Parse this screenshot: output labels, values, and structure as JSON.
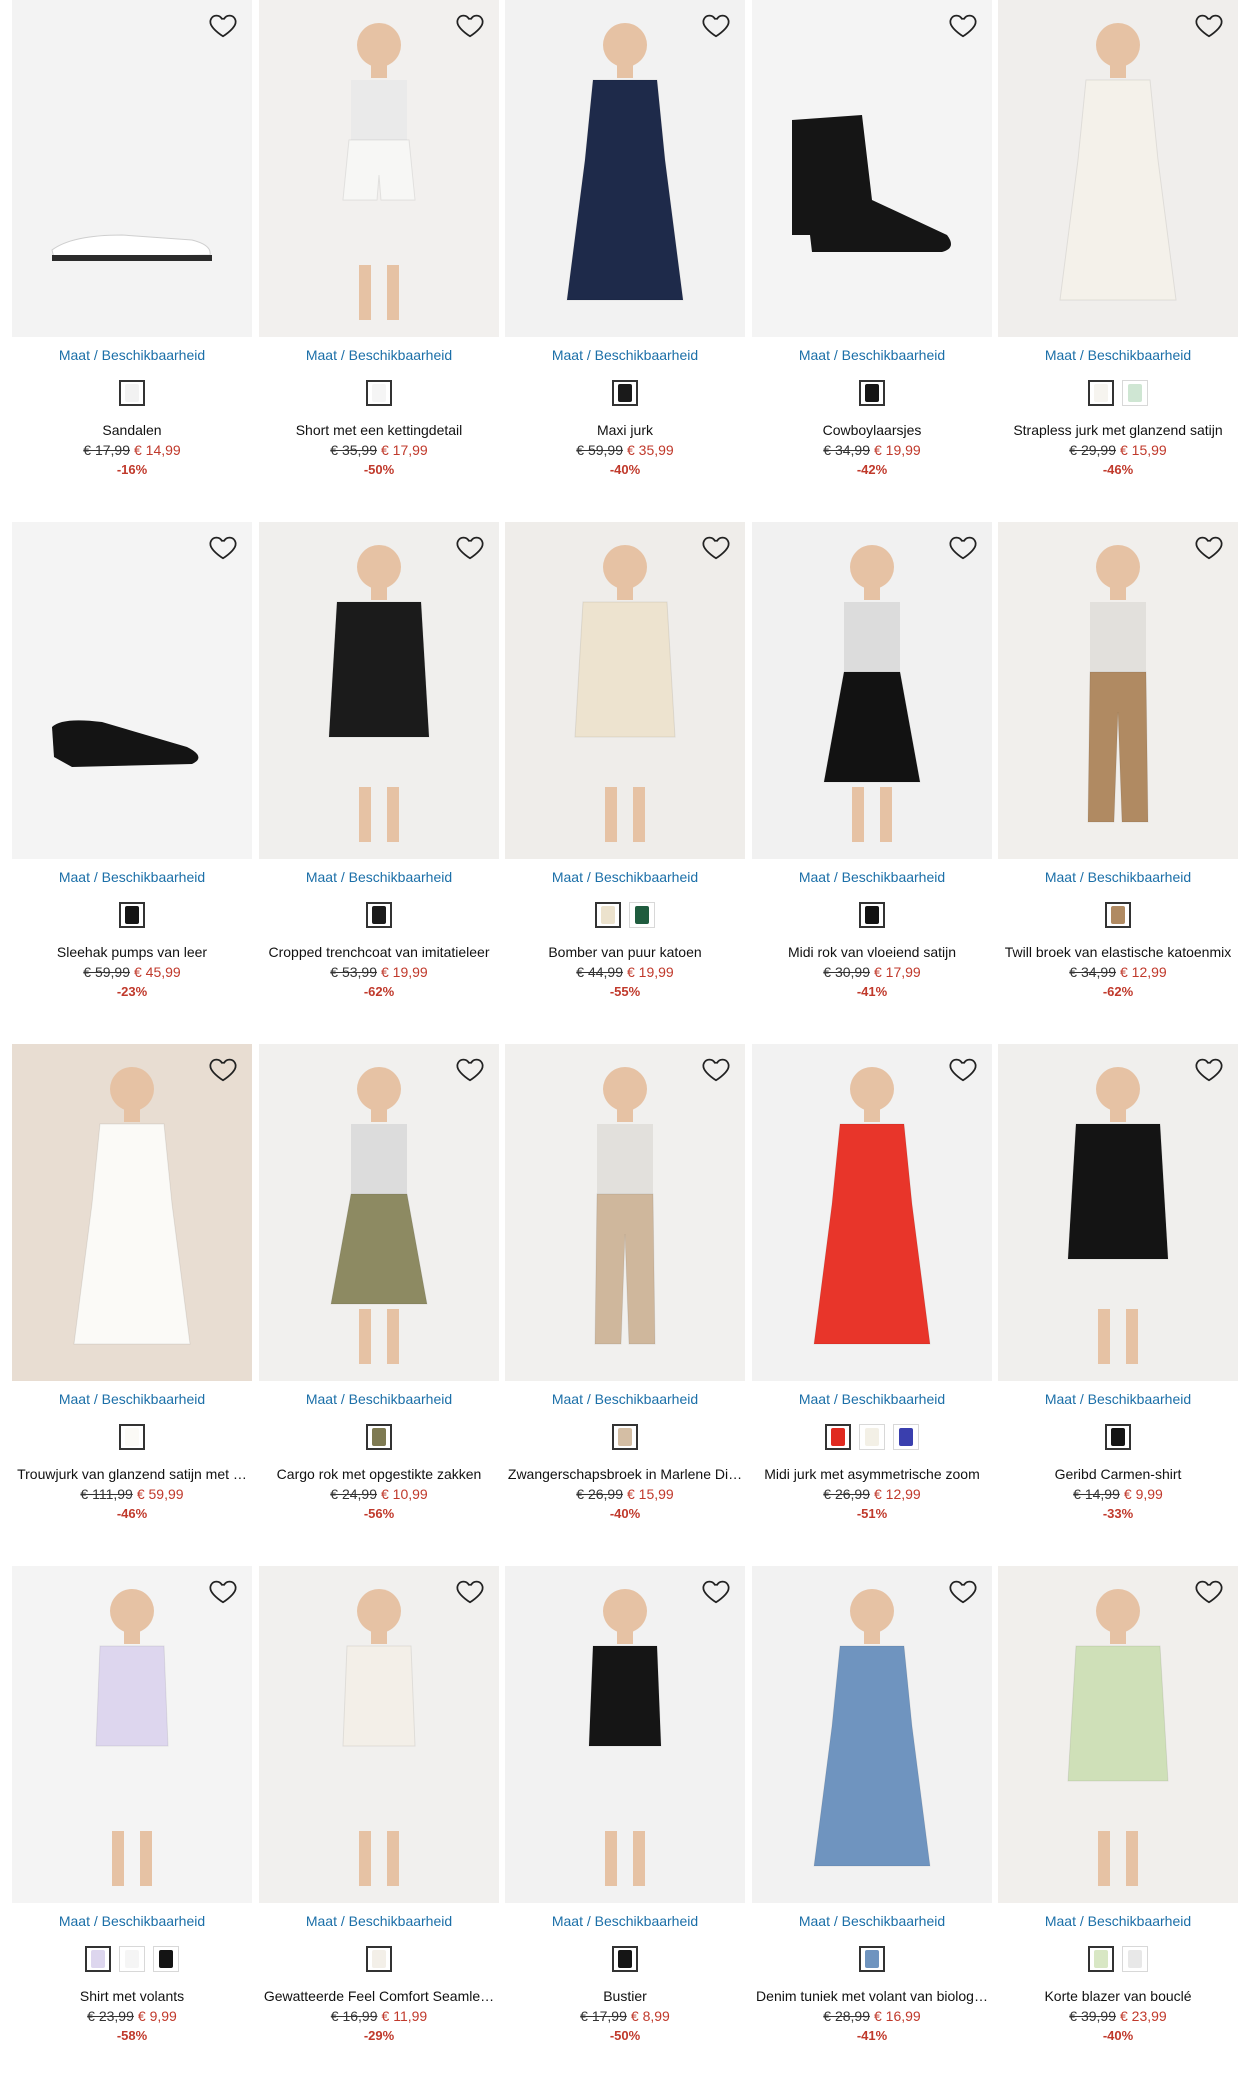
{
  "grid": {
    "size_link_label": "Maat / Beschikbaarheid",
    "products": [
      {
        "name": "Sandalen",
        "old_price": "€ 17,99",
        "new_price": "€ 14,99",
        "discount": "-16%",
        "bg": "#f3f3f3",
        "tone": "#ffffff",
        "swatches": [
          "#f2f2f2"
        ],
        "kind": "shoe"
      },
      {
        "name": "Short met een kettingdetail",
        "old_price": "€ 35,99",
        "new_price": "€ 17,99",
        "discount": "-50%",
        "bg": "#f2f0ee",
        "tone": "#f7f7f5",
        "swatches": [
          "#f5f5f5"
        ],
        "kind": "shorts"
      },
      {
        "name": "Maxi jurk",
        "old_price": "€ 59,99",
        "new_price": "€ 35,99",
        "discount": "-40%",
        "bg": "#f2f2f2",
        "tone": "#1e2a4a",
        "swatches": [
          "#1a1a1a"
        ],
        "kind": "dress"
      },
      {
        "name": "Cowboylaarsjes",
        "old_price": "€ 34,99",
        "new_price": "€ 19,99",
        "discount": "-42%",
        "bg": "#f4f4f4",
        "tone": "#151515",
        "swatches": [
          "#151515"
        ],
        "kind": "boot"
      },
      {
        "name": "Strapless jurk met glanzend satijn",
        "old_price": "€ 29,99",
        "new_price": "€ 15,99",
        "discount": "-46%",
        "bg": "#f0eeec",
        "tone": "#f4f1ea",
        "swatches": [
          "#f6f4ef",
          "#cfe6d3"
        ],
        "kind": "dress"
      },
      {
        "name": "Sleehak pumps van leer",
        "old_price": "€ 59,99",
        "new_price": "€ 45,99",
        "discount": "-23%",
        "bg": "#f4f4f4",
        "tone": "#141414",
        "swatches": [
          "#141414"
        ],
        "kind": "pump"
      },
      {
        "name": "Cropped trenchcoat van imitatieleer",
        "old_price": "€ 53,99",
        "new_price": "€ 19,99",
        "discount": "-62%",
        "bg": "#f0efed",
        "tone": "#1b1b1b",
        "swatches": [
          "#1b1b1b"
        ],
        "kind": "jacket"
      },
      {
        "name": "Bomber van puur katoen",
        "old_price": "€ 44,99",
        "new_price": "€ 19,99",
        "discount": "-55%",
        "bg": "#efedea",
        "tone": "#ede3cf",
        "swatches": [
          "#ece2cd",
          "#1f5c3e"
        ],
        "kind": "jacket"
      },
      {
        "name": "Midi rok van vloeiend satijn",
        "old_price": "€ 30,99",
        "new_price": "€ 17,99",
        "discount": "-41%",
        "bg": "#f1f1f1",
        "tone": "#121212",
        "swatches": [
          "#121212"
        ],
        "kind": "skirt"
      },
      {
        "name": "Twill broek van elastische katoenmix",
        "old_price": "€ 34,99",
        "new_price": "€ 12,99",
        "discount": "-62%",
        "bg": "#f1efec",
        "tone": "#b08a62",
        "swatches": [
          "#b08a62"
        ],
        "kind": "pants"
      },
      {
        "name": "Trouwjurk van glanzend satijn met …",
        "old_price": "€ 111,99",
        "new_price": "€ 59,99",
        "discount": "-46%",
        "bg": "#e8ddd2",
        "tone": "#fbfaf7",
        "swatches": [
          "#fbfaf6"
        ],
        "kind": "dress"
      },
      {
        "name": "Cargo rok met opgestikte zakken",
        "old_price": "€ 24,99",
        "new_price": "€ 10,99",
        "discount": "-56%",
        "bg": "#f1f0ee",
        "tone": "#8d8a62",
        "swatches": [
          "#7e7a52"
        ],
        "kind": "skirt"
      },
      {
        "name": "Zwangerschapsbroek in Marlene Di…",
        "old_price": "€ 26,99",
        "new_price": "€ 15,99",
        "discount": "-40%",
        "bg": "#f1f0ee",
        "tone": "#cfb79c",
        "swatches": [
          "#d4bea4"
        ],
        "kind": "pants"
      },
      {
        "name": "Midi jurk met asymmetrische zoom",
        "old_price": "€ 26,99",
        "new_price": "€ 12,99",
        "discount": "-51%",
        "bg": "#f2f2f2",
        "tone": "#e8352a",
        "swatches": [
          "#e02a20",
          "#f3f0e6",
          "#3a3fae"
        ],
        "kind": "dress"
      },
      {
        "name": "Geribd Carmen-shirt",
        "old_price": "€ 14,99",
        "new_price": "€ 9,99",
        "discount": "-33%",
        "bg": "#f0efed",
        "tone": "#141414",
        "swatches": [
          "#141414"
        ],
        "kind": "jacket"
      },
      {
        "name": "Shirt met volants",
        "old_price": "€ 23,99",
        "new_price": "€ 9,99",
        "discount": "-58%",
        "bg": "#f4f4f4",
        "tone": "#ddd6ee",
        "swatches": [
          "#ddd6ee",
          "#f5f5f5",
          "#141414"
        ],
        "kind": "top"
      },
      {
        "name": "Gewatteerde Feel Comfort Seamle…",
        "old_price": "€ 16,99",
        "new_price": "€ 11,99",
        "discount": "-29%",
        "bg": "#f1f0ee",
        "tone": "#f3efe8",
        "swatches": [
          "#f3efe8"
        ],
        "kind": "top"
      },
      {
        "name": "Bustier",
        "old_price": "€ 17,99",
        "new_price": "€ 8,99",
        "discount": "-50%",
        "bg": "#f2f2f2",
        "tone": "#151515",
        "swatches": [
          "#151515"
        ],
        "kind": "body"
      },
      {
        "name": "Denim tuniek met volant van biolog…",
        "old_price": "€ 28,99",
        "new_price": "€ 16,99",
        "discount": "-41%",
        "bg": "#f2f2f2",
        "tone": "#6f94bf",
        "swatches": [
          "#6f94bf"
        ],
        "kind": "dress"
      },
      {
        "name": "Korte blazer van bouclé",
        "old_price": "€ 39,99",
        "new_price": "€ 23,99",
        "discount": "-40%",
        "bg": "#f1efec",
        "tone": "#cfe0b8",
        "swatches": [
          "#d8e7c4",
          "#e8e8e8"
        ],
        "kind": "jacket"
      }
    ]
  }
}
